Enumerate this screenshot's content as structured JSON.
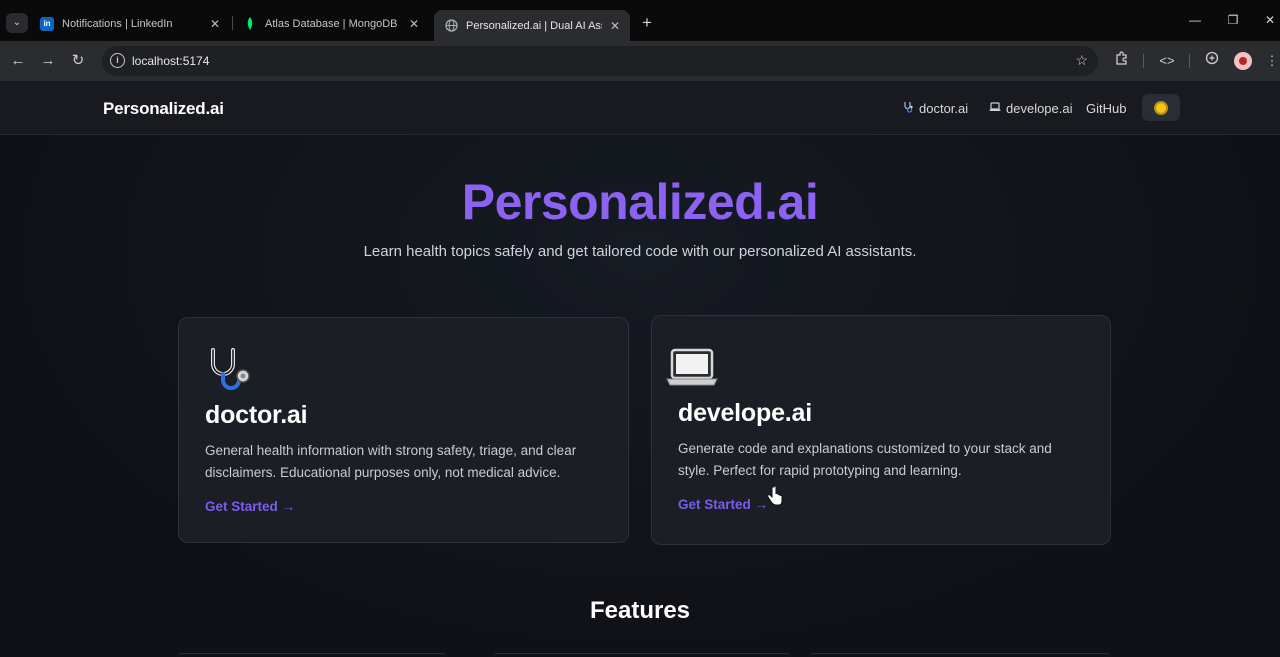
{
  "browser": {
    "tabs": [
      {
        "title": "Notifications | LinkedIn",
        "favicon": "linkedin-icon",
        "favicon_text": "in",
        "favicon_color": "#0a66c2"
      },
      {
        "title": "Atlas Database | MongoDB",
        "favicon": "mongodb-leaf-icon",
        "favicon_color": "#00ed64"
      },
      {
        "title": "Personalized.ai | Dual AI Assista",
        "favicon": "globe-icon",
        "favicon_color": "#9aa0a6",
        "active": true
      }
    ],
    "close_glyph": "✕",
    "new_tab_glyph": "+",
    "url": "localhost:5174"
  },
  "site": {
    "brand": "Personalized.ai",
    "nav": [
      {
        "label": "doctor.ai",
        "icon": "stethoscope-icon"
      },
      {
        "label": "develope.ai",
        "icon": "laptop-icon"
      },
      {
        "label": "GitHub"
      }
    ],
    "theme_toggle_icon": "sun-icon"
  },
  "hero": {
    "title": "Personalized.ai",
    "subtitle": "Learn health topics safely and get tailored code with our personalized AI assistants.",
    "title_color": "#8b63f0"
  },
  "cards": [
    {
      "icon": "stethoscope-icon",
      "title": "doctor.ai",
      "description": "General health information with strong safety, triage, and clear disclaimers. Educational purposes only, not medical advice.",
      "cta": "Get Started →"
    },
    {
      "icon": "laptop-icon",
      "title": "develope.ai",
      "description": "Generate code and explanations customized to your stack and style. Perfect for rapid prototyping and learning.",
      "cta": "Get Started →"
    }
  ],
  "features": {
    "heading": "Features"
  },
  "colors": {
    "accent": "#7a5cf0",
    "background": "#0f1116",
    "card": "#1b1e25"
  }
}
